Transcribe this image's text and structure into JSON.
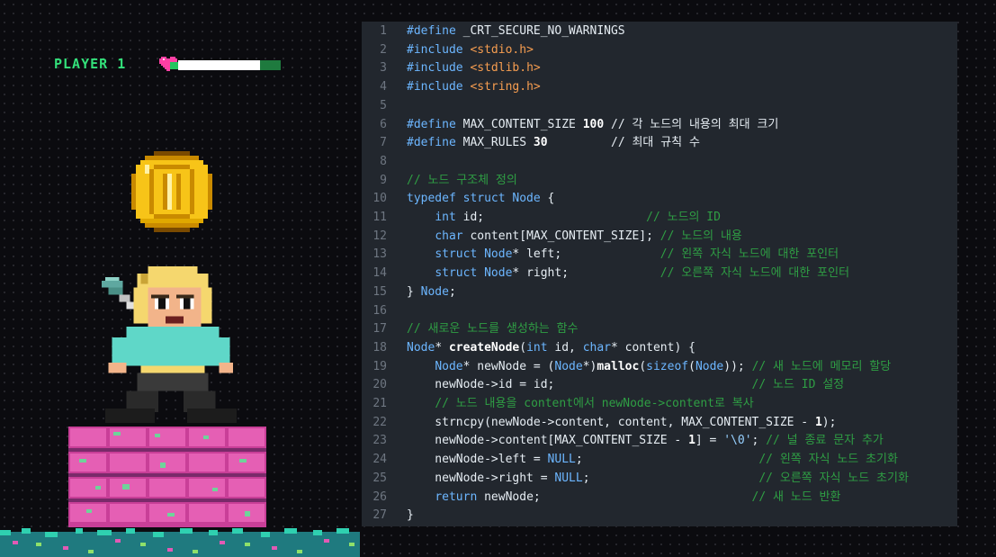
{
  "hud": {
    "label": "PLAYER 1",
    "health_fraction": 0.8
  },
  "colors": {
    "background": "#0b0b0f",
    "hud_green": "#33e07a",
    "coin": "#f7c418",
    "platform": "#e04fa7",
    "code_bg": "#22272e",
    "keyword": "#6cb6ff",
    "string": "#f69d50",
    "comment": "#2f9e44"
  },
  "icons": [
    "heart-icon",
    "coin-icon",
    "hero-sprite"
  ],
  "code": {
    "lines": [
      {
        "n": "1",
        "tokens": [
          {
            "c": "kw",
            "t": "#define"
          },
          {
            "c": "text",
            "t": " _CRT_SECURE_NO_WARNINGS"
          }
        ]
      },
      {
        "n": "2",
        "tokens": [
          {
            "c": "kw",
            "t": "#include"
          },
          {
            "c": "text",
            "t": " "
          },
          {
            "c": "str",
            "t": "<stdio.h>"
          }
        ]
      },
      {
        "n": "3",
        "tokens": [
          {
            "c": "kw",
            "t": "#include"
          },
          {
            "c": "text",
            "t": " "
          },
          {
            "c": "str",
            "t": "<stdlib.h>"
          }
        ]
      },
      {
        "n": "4",
        "tokens": [
          {
            "c": "kw",
            "t": "#include"
          },
          {
            "c": "text",
            "t": " "
          },
          {
            "c": "str",
            "t": "<string.h>"
          }
        ]
      },
      {
        "n": "5",
        "tokens": []
      },
      {
        "n": "6",
        "tokens": [
          {
            "c": "kw",
            "t": "#define"
          },
          {
            "c": "text",
            "t": " MAX_CONTENT_SIZE "
          },
          {
            "c": "num",
            "t": "100"
          },
          {
            "c": "text",
            "t": " // 각 노드의 내용의 최대 크기"
          }
        ]
      },
      {
        "n": "7",
        "tokens": [
          {
            "c": "kw",
            "t": "#define"
          },
          {
            "c": "text",
            "t": " MAX_RULES "
          },
          {
            "c": "num",
            "t": "30"
          },
          {
            "c": "text",
            "t": "         // 최대 규칙 수"
          }
        ]
      },
      {
        "n": "8",
        "tokens": []
      },
      {
        "n": "9",
        "tokens": [
          {
            "c": "com",
            "t": "// 노드 구조체 정의"
          }
        ]
      },
      {
        "n": "10",
        "tokens": [
          {
            "c": "kw",
            "t": "typedef struct"
          },
          {
            "c": "text",
            "t": " "
          },
          {
            "c": "kw",
            "t": "Node"
          },
          {
            "c": "text",
            "t": " {"
          }
        ]
      },
      {
        "n": "11",
        "tokens": [
          {
            "c": "text",
            "t": "    "
          },
          {
            "c": "kw",
            "t": "int"
          },
          {
            "c": "text",
            "t": " id;                       "
          },
          {
            "c": "com",
            "t": "// 노드의 ID"
          }
        ]
      },
      {
        "n": "12",
        "tokens": [
          {
            "c": "text",
            "t": "    "
          },
          {
            "c": "kw",
            "t": "char"
          },
          {
            "c": "text",
            "t": " content[MAX_CONTENT_SIZE]; "
          },
          {
            "c": "com",
            "t": "// 노드의 내용"
          }
        ]
      },
      {
        "n": "13",
        "tokens": [
          {
            "c": "text",
            "t": "    "
          },
          {
            "c": "kw",
            "t": "struct"
          },
          {
            "c": "text",
            "t": " "
          },
          {
            "c": "kw",
            "t": "Node"
          },
          {
            "c": "text",
            "t": "* left;              "
          },
          {
            "c": "com",
            "t": "// 왼쪽 자식 노드에 대한 포인터"
          }
        ]
      },
      {
        "n": "14",
        "tokens": [
          {
            "c": "text",
            "t": "    "
          },
          {
            "c": "kw",
            "t": "struct"
          },
          {
            "c": "text",
            "t": " "
          },
          {
            "c": "kw",
            "t": "Node"
          },
          {
            "c": "text",
            "t": "* right;             "
          },
          {
            "c": "com",
            "t": "// 오른쪽 자식 노드에 대한 포인터"
          }
        ]
      },
      {
        "n": "15",
        "tokens": [
          {
            "c": "text",
            "t": "} "
          },
          {
            "c": "kw",
            "t": "Node"
          },
          {
            "c": "text",
            "t": ";"
          }
        ]
      },
      {
        "n": "16",
        "tokens": []
      },
      {
        "n": "17",
        "tokens": [
          {
            "c": "com",
            "t": "// 새로운 노드를 생성하는 함수"
          }
        ]
      },
      {
        "n": "18",
        "tokens": [
          {
            "c": "kw",
            "t": "Node"
          },
          {
            "c": "text",
            "t": "* "
          },
          {
            "c": "fn",
            "t": "createNode"
          },
          {
            "c": "text",
            "t": "("
          },
          {
            "c": "kw",
            "t": "int"
          },
          {
            "c": "text",
            "t": " id, "
          },
          {
            "c": "kw",
            "t": "char"
          },
          {
            "c": "text",
            "t": "* content) {"
          }
        ]
      },
      {
        "n": "19",
        "tokens": [
          {
            "c": "text",
            "t": "    "
          },
          {
            "c": "kw",
            "t": "Node"
          },
          {
            "c": "text",
            "t": "* newNode = ("
          },
          {
            "c": "kw",
            "t": "Node"
          },
          {
            "c": "text",
            "t": "*)"
          },
          {
            "c": "fn",
            "t": "malloc"
          },
          {
            "c": "text",
            "t": "("
          },
          {
            "c": "kw",
            "t": "sizeof"
          },
          {
            "c": "text",
            "t": "("
          },
          {
            "c": "kw",
            "t": "Node"
          },
          {
            "c": "text",
            "t": ")); "
          },
          {
            "c": "com",
            "t": "// 새 노드에 메모리 할당"
          }
        ]
      },
      {
        "n": "20",
        "tokens": [
          {
            "c": "text",
            "t": "    newNode->id = id;                            "
          },
          {
            "c": "com",
            "t": "// 노드 ID 설정"
          }
        ]
      },
      {
        "n": "21",
        "tokens": [
          {
            "c": "text",
            "t": "    "
          },
          {
            "c": "com",
            "t": "// 노드 내용을 content에서 newNode->content로 복사"
          }
        ]
      },
      {
        "n": "22",
        "tokens": [
          {
            "c": "text",
            "t": "    strncpy(newNode->content, content, MAX_CONTENT_SIZE - "
          },
          {
            "c": "num",
            "t": "1"
          },
          {
            "c": "text",
            "t": ");"
          }
        ]
      },
      {
        "n": "23",
        "tokens": [
          {
            "c": "text",
            "t": "    newNode->content[MAX_CONTENT_SIZE - "
          },
          {
            "c": "num",
            "t": "1"
          },
          {
            "c": "text",
            "t": "] = "
          },
          {
            "c": "chr",
            "t": "'\\0'"
          },
          {
            "c": "text",
            "t": "; "
          },
          {
            "c": "com",
            "t": "// 널 종료 문자 추가"
          }
        ]
      },
      {
        "n": "24",
        "tokens": [
          {
            "c": "text",
            "t": "    newNode->left = "
          },
          {
            "c": "kw",
            "t": "NULL"
          },
          {
            "c": "text",
            "t": ";                         "
          },
          {
            "c": "com",
            "t": "// 왼쪽 자식 노드 초기화"
          }
        ]
      },
      {
        "n": "25",
        "tokens": [
          {
            "c": "text",
            "t": "    newNode->right = "
          },
          {
            "c": "kw",
            "t": "NULL"
          },
          {
            "c": "text",
            "t": ";                        "
          },
          {
            "c": "com",
            "t": "// 오른쪽 자식 노드 초기화"
          }
        ]
      },
      {
        "n": "26",
        "tokens": [
          {
            "c": "text",
            "t": "    "
          },
          {
            "c": "kw",
            "t": "return"
          },
          {
            "c": "text",
            "t": " newNode;                              "
          },
          {
            "c": "com",
            "t": "// 새 노드 반환"
          }
        ]
      },
      {
        "n": "27",
        "tokens": [
          {
            "c": "text",
            "t": "}"
          }
        ]
      }
    ]
  }
}
